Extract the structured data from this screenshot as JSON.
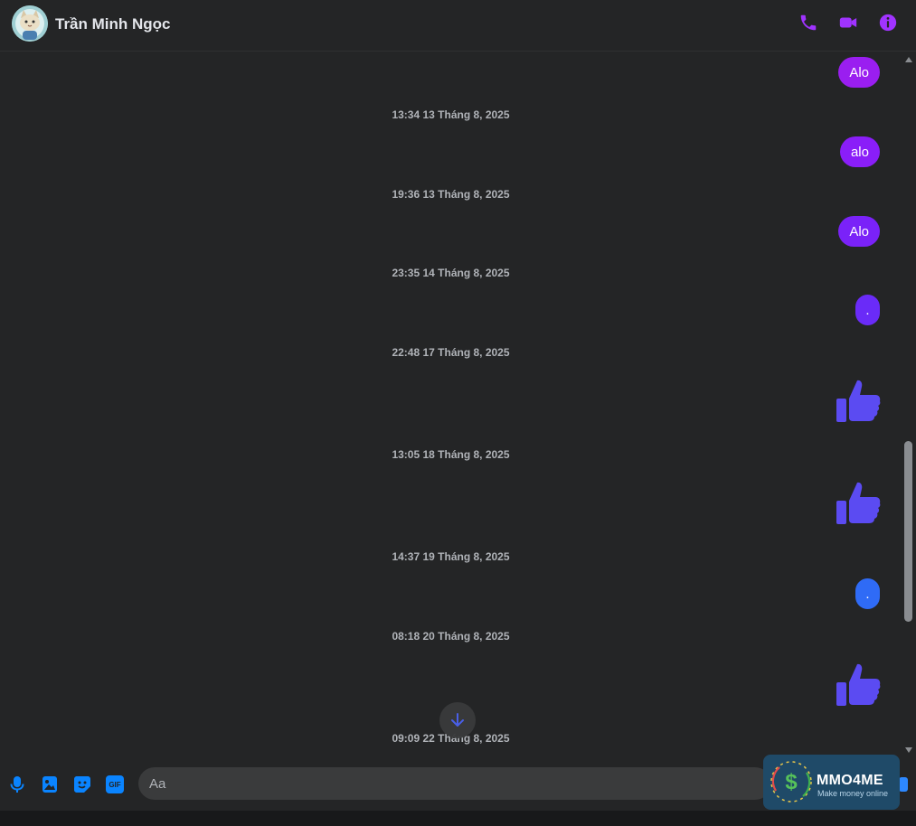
{
  "header": {
    "contact_name": "Trần Minh Ngọc",
    "avatar_icon": "cat-avatar-icon",
    "actions": [
      {
        "name": "phone-icon",
        "color": "#a033ff"
      },
      {
        "name": "video-camera-icon",
        "color": "#a033ff"
      },
      {
        "name": "info-icon",
        "color": "#a033ff"
      }
    ]
  },
  "messages": [
    {
      "kind": "bubble",
      "text": "Alo",
      "color": "#9a1ef0"
    },
    {
      "kind": "timestamp",
      "text": "13:34 13 Tháng 8, 2025"
    },
    {
      "kind": "bubble",
      "text": "alo",
      "color": "#8a1ef8"
    },
    {
      "kind": "timestamp",
      "text": "19:36 13 Tháng 8, 2025"
    },
    {
      "kind": "bubble",
      "text": "Alo",
      "color": "#7a22f8"
    },
    {
      "kind": "timestamp",
      "text": "23:35 14 Tháng 8, 2025"
    },
    {
      "kind": "bubble",
      "text": ".",
      "color": "#6a2bf8"
    },
    {
      "kind": "timestamp",
      "text": "22:48 17 Tháng 8, 2025"
    },
    {
      "kind": "like",
      "icon": "thumbs-up-icon",
      "color": "#5b4bf2"
    },
    {
      "kind": "timestamp",
      "text": "13:05 18 Tháng 8, 2025"
    },
    {
      "kind": "like",
      "icon": "thumbs-up-icon",
      "color": "#5b4bf2"
    },
    {
      "kind": "timestamp",
      "text": "14:37 19 Tháng 8, 2025"
    },
    {
      "kind": "bubble",
      "text": ".",
      "color": "#2f6bf6"
    },
    {
      "kind": "timestamp",
      "text": "08:18 20 Tháng 8, 2025"
    },
    {
      "kind": "like",
      "icon": "thumbs-up-icon",
      "color": "#5b4bf2"
    },
    {
      "kind": "timestamp",
      "text": "09:09 22 Tháng 8, 2025"
    }
  ],
  "jump_button": {
    "icon": "arrow-down-icon",
    "color": "#4b63f2"
  },
  "composer": {
    "icons": [
      {
        "name": "microphone-icon",
        "color": "#0a84ff"
      },
      {
        "name": "image-icon",
        "color": "#0a84ff"
      },
      {
        "name": "sticker-icon",
        "color": "#0a84ff"
      },
      {
        "name": "gif-icon",
        "color": "#0a84ff",
        "label": "GIF"
      }
    ],
    "placeholder": "Aa"
  },
  "watermark": {
    "title": "MMO4ME",
    "subtitle": "Make money online",
    "symbol": "$"
  }
}
